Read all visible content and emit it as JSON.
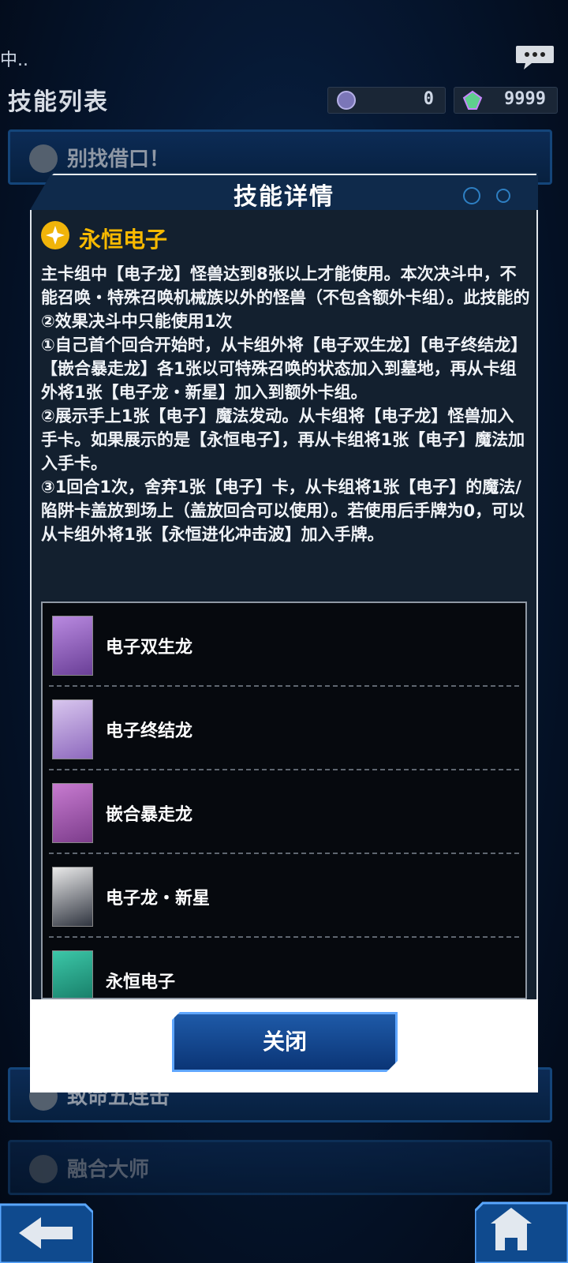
{
  "header": {
    "back_text": "中..",
    "title": "技能列表",
    "currency": [
      {
        "icon": "orb-icon",
        "value": "0"
      },
      {
        "icon": "gem-icon",
        "value": "9999"
      }
    ]
  },
  "skill_list": [
    {
      "label": "别找借口！"
    },
    {
      "label": "致命五连击"
    },
    {
      "label": "融合大师"
    }
  ],
  "modal": {
    "title": "技能详情",
    "skill_name": "永恒电子",
    "description": [
      "主卡组中【电子龙】怪兽达到8张以上才能使用。本次决斗中，不能召唤・特殊召唤机械族以外的怪兽（不包含额外卡组）。此技能的②效果决斗中只能使用1次",
      "①自己首个回合开始时，从卡组外将【电子双生龙】【电子终结龙】【嵌合暴走龙】各1张以可特殊召唤的状态加入到墓地，再从卡组外将1张【电子龙・新星】加入到额外卡组。",
      "②展示手上1张【电子】魔法发动。从卡组将【电子龙】怪兽加入手卡。如果展示的是【永恒电子】，再从卡组将1张【电子】魔法加入手卡。",
      "③1回合1次，舍弃1张【电子】卡，从卡组将1张【电子】的魔法/陷阱卡盖放到场上（盖放回合可以使用）。若使用后手牌为0，可以从卡组外将1张【永恒进化冲击波】加入手牌。"
    ],
    "cards": [
      {
        "name": "电子双生龙",
        "color": "#8a5bb5"
      },
      {
        "name": "电子终结龙",
        "color": "#a07ac8"
      },
      {
        "name": "嵌合暴走龙",
        "color": "#9b4fa8"
      },
      {
        "name": "电子龙・新星",
        "color": "#2a2f3a"
      },
      {
        "name": "永恒电子",
        "color": "#1fa08a"
      }
    ],
    "close_label": "关闭"
  },
  "nav": {
    "back_icon": "back-arrow-icon",
    "home_icon": "home-icon"
  }
}
